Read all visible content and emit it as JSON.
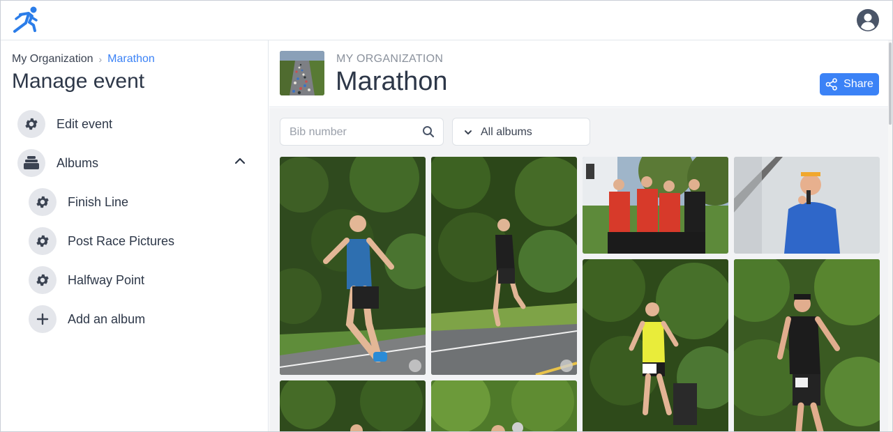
{
  "topbar": {
    "logo_icon": "running-man-icon",
    "account_icon": "user-circle-icon",
    "brand_color": "#2b7de9"
  },
  "sidebar": {
    "breadcrumb": {
      "root": "My Organization",
      "separator": "›",
      "current": "Marathon"
    },
    "title": "Manage event",
    "items": [
      {
        "label": "Edit event",
        "icon": "gear-icon"
      },
      {
        "label": "Albums",
        "icon": "albums-icon",
        "expanded": true
      },
      {
        "label": "Finish Line",
        "icon": "gear-icon"
      },
      {
        "label": "Post Race Pictures",
        "icon": "gear-icon"
      },
      {
        "label": "Halfway Point",
        "icon": "gear-icon"
      },
      {
        "label": "Add an album",
        "icon": "plus-icon"
      }
    ]
  },
  "header": {
    "org_label": "MY ORGANIZATION",
    "event_title": "Marathon",
    "share_label": "Share",
    "accent_color": "#3b82f6"
  },
  "filters": {
    "bib_placeholder": "Bib number",
    "album_value": "All albums"
  },
  "photos": [
    {
      "id": "p1",
      "subject": "runner-blue-vest"
    },
    {
      "id": "p2",
      "subject": "runner-black-shirt"
    },
    {
      "id": "p3",
      "subject": "group-red-shirts"
    },
    {
      "id": "p4",
      "subject": "man-blue-microphone"
    },
    {
      "id": "p5",
      "subject": "runner-yellow-shirt"
    },
    {
      "id": "p6",
      "subject": "runner-black-cap"
    },
    {
      "id": "p7",
      "subject": "runner"
    },
    {
      "id": "p8",
      "subject": "runner"
    }
  ]
}
